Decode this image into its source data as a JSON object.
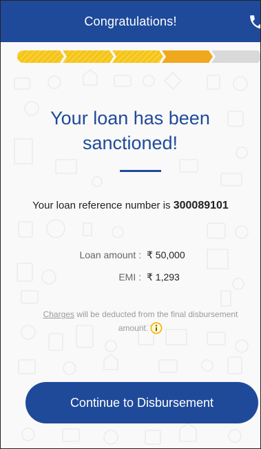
{
  "header": {
    "title": "Congratulations!",
    "phone_icon": "phone-icon"
  },
  "progress": {
    "steps_total": 5,
    "steps_completed": 3,
    "steps_active": 1,
    "colors": {
      "completed": "#f5c518",
      "active": "#f0a81e",
      "pending": "#d9d9d9"
    }
  },
  "main": {
    "headline_line1": "Your loan has been",
    "headline_line2": "sanctioned!",
    "reference_prefix": "Your loan reference number is ",
    "reference_number": "300089101",
    "details": {
      "loan_amount_label": "Loan amount :",
      "loan_amount_value": "₹ 50,000",
      "emi_label": "EMI :",
      "emi_value": "₹ 1,293"
    },
    "charges_link": "Charges",
    "charges_text": " will be deducted from the final disbursement amount.",
    "info_icon": "info-icon"
  },
  "cta": {
    "label": "Continue to Disbursement"
  },
  "colors": {
    "brand": "#1f4a9a",
    "accent": "#f5c518",
    "background": "#f9f9f9"
  }
}
